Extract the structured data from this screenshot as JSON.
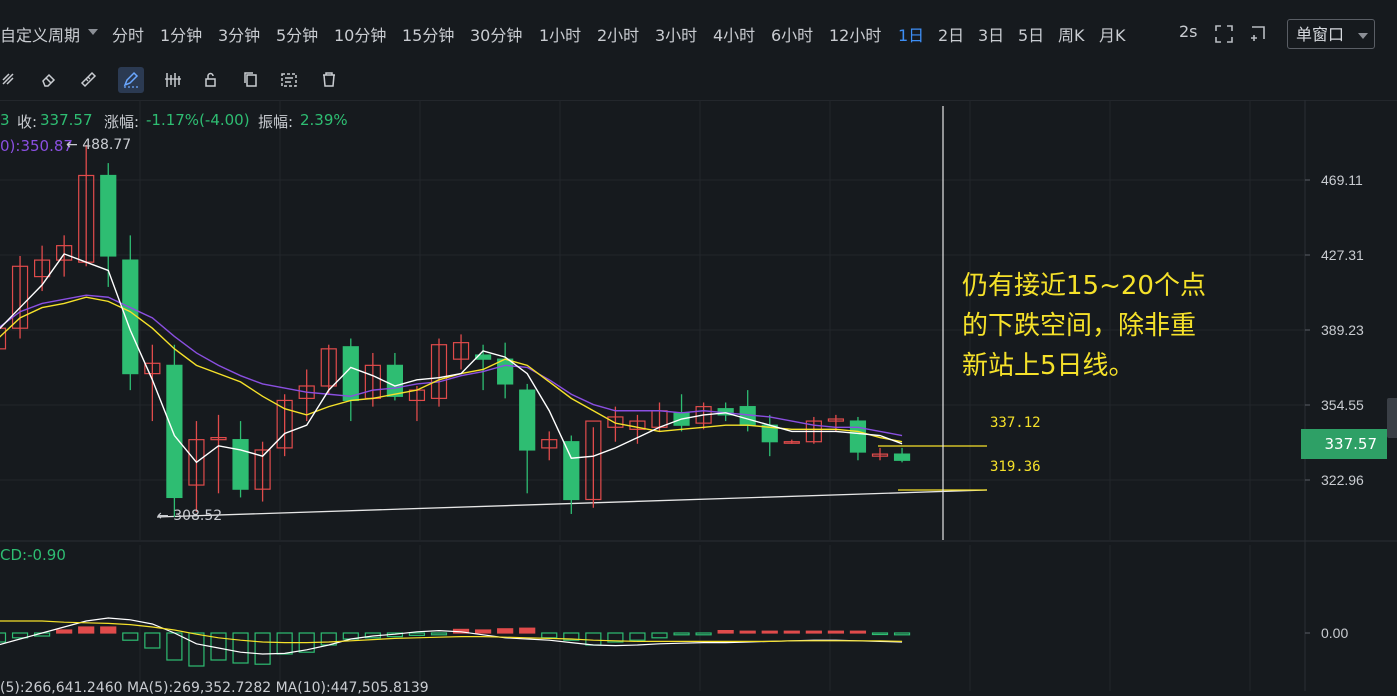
{
  "toolbar": {
    "periods": [
      "自定义周期",
      "分时",
      "1分钟",
      "3分钟",
      "5分钟",
      "10分钟",
      "15分钟",
      "30分钟",
      "1小时",
      "2小时",
      "3小时",
      "4小时",
      "6小时",
      "12小时",
      "1日",
      "2日",
      "3日",
      "5日",
      "周K",
      "月K"
    ],
    "active_period": "1日",
    "refresh": "2s",
    "window_mode": "单窗口",
    "drawing_tools": [
      "pattern-tool-icon",
      "eraser-icon",
      "ruler-icon",
      "pen-tool-icon",
      "candle-tool-icon",
      "lock-icon",
      "copy-icon",
      "settings-tool-icon",
      "trash-icon"
    ],
    "selected_tool": "pen-tool-icon"
  },
  "info": {
    "close_label": "收:",
    "close_value": "337.57",
    "change_label": "涨幅:",
    "change_value": "-1.17%(-4.00)",
    "amplitude_label": "振幅:",
    "amplitude_value": "2.39%",
    "ma_value": "0):350.87",
    "leading_digit": "3"
  },
  "annotation": {
    "text_lines": [
      "仍有接近15~20个点",
      "的下跌空间，除非重",
      "新站上5日线。"
    ],
    "level_upper": "337.12",
    "level_lower": "319.36"
  },
  "extremes": {
    "high": "488.77",
    "low": "308.52"
  },
  "macd": {
    "label": "CD:-0.90",
    "zero_label": "0.00",
    "bottom_text": "(5):266,641.2460  MA(5):269,352.7282  MA(10):447,505.8139"
  },
  "colors": {
    "up": "#e04b4b",
    "down": "#2ebd72",
    "ma5": "#ffffff",
    "ma10": "#f5e12a",
    "ma20": "#8a4fe0",
    "annotation": "#f5e12a",
    "price_tag": "#2ea066"
  },
  "chart_data": {
    "type": "candlestick",
    "y_ticks": [
      469.11,
      427.31,
      389.23,
      354.55,
      322.96
    ],
    "current_price": 337.57,
    "ylim": [
      301,
      500
    ],
    "candles": [
      {
        "o": 390,
        "h": 405,
        "l": 380,
        "c": 400
      },
      {
        "o": 400,
        "h": 435,
        "l": 395,
        "c": 430
      },
      {
        "o": 425,
        "h": 440,
        "l": 418,
        "c": 433
      },
      {
        "o": 433,
        "h": 445,
        "l": 425,
        "c": 440
      },
      {
        "o": 432,
        "h": 488.77,
        "l": 430,
        "c": 474
      },
      {
        "o": 474,
        "h": 480,
        "l": 420,
        "c": 435
      },
      {
        "o": 433,
        "h": 445,
        "l": 370,
        "c": 378
      },
      {
        "o": 378,
        "h": 392,
        "l": 355,
        "c": 383
      },
      {
        "o": 382,
        "h": 392,
        "l": 308.52,
        "c": 318
      },
      {
        "o": 324,
        "h": 355,
        "l": 311,
        "c": 346
      },
      {
        "o": 346,
        "h": 358,
        "l": 320,
        "c": 347
      },
      {
        "o": 346,
        "h": 355,
        "l": 318,
        "c": 322
      },
      {
        "o": 322,
        "h": 345,
        "l": 316,
        "c": 341
      },
      {
        "o": 342,
        "h": 368,
        "l": 338,
        "c": 365
      },
      {
        "o": 366,
        "h": 380,
        "l": 355,
        "c": 372
      },
      {
        "o": 372,
        "h": 392,
        "l": 368,
        "c": 390
      },
      {
        "o": 391,
        "h": 395,
        "l": 355,
        "c": 365
      },
      {
        "o": 366,
        "h": 388,
        "l": 362,
        "c": 382
      },
      {
        "o": 382,
        "h": 388,
        "l": 365,
        "c": 367
      },
      {
        "o": 365,
        "h": 372,
        "l": 355,
        "c": 370
      },
      {
        "o": 366,
        "h": 395,
        "l": 362,
        "c": 392
      },
      {
        "o": 385,
        "h": 397,
        "l": 380,
        "c": 393
      },
      {
        "o": 387,
        "h": 392,
        "l": 370,
        "c": 385
      },
      {
        "o": 385,
        "h": 393,
        "l": 366,
        "c": 373
      },
      {
        "o": 370,
        "h": 373,
        "l": 320,
        "c": 341
      },
      {
        "o": 342,
        "h": 350,
        "l": 336,
        "c": 346
      },
      {
        "o": 345,
        "h": 348,
        "l": 310,
        "c": 317
      },
      {
        "o": 317,
        "h": 352,
        "l": 313,
        "c": 355
      },
      {
        "o": 352,
        "h": 362,
        "l": 345,
        "c": 357
      },
      {
        "o": 351,
        "h": 358,
        "l": 344,
        "c": 355
      },
      {
        "o": 352,
        "h": 364,
        "l": 350,
        "c": 360
      },
      {
        "o": 359,
        "h": 368,
        "l": 350,
        "c": 353
      },
      {
        "o": 354,
        "h": 364,
        "l": 351,
        "c": 362
      },
      {
        "o": 361,
        "h": 364,
        "l": 355,
        "c": 358
      },
      {
        "o": 362,
        "h": 370,
        "l": 350,
        "c": 353
      },
      {
        "o": 353,
        "h": 358,
        "l": 338,
        "c": 345
      },
      {
        "o": 345,
        "h": 346,
        "l": 344,
        "c": 345
      },
      {
        "o": 345,
        "h": 357,
        "l": 344,
        "c": 355
      },
      {
        "o": 355,
        "h": 358,
        "l": 350,
        "c": 356
      },
      {
        "o": 355,
        "h": 357,
        "l": 336,
        "c": 340
      },
      {
        "o": 338,
        "h": 342,
        "l": 336,
        "c": 339
      },
      {
        "o": 339,
        "h": 342,
        "l": 335,
        "c": 336
      }
    ],
    "ma5": [
      399,
      410,
      421,
      436,
      432,
      428,
      399,
      375,
      348,
      335,
      343,
      341,
      338,
      349,
      353,
      370,
      381,
      377,
      372,
      375,
      376,
      378,
      389,
      386,
      378,
      360,
      337,
      338,
      342,
      347,
      352,
      356,
      358,
      359,
      356,
      353,
      350,
      350,
      350,
      349,
      348,
      344
    ],
    "ma10": [
      395,
      405,
      410,
      412,
      415,
      413,
      408,
      400,
      390,
      382,
      378,
      374,
      367,
      361,
      358,
      362,
      365,
      366,
      368,
      370,
      375,
      378,
      380,
      385,
      382,
      374,
      366,
      360,
      354,
      352,
      350,
      351,
      352,
      353,
      353,
      352,
      351,
      351,
      351,
      350,
      347,
      345
    ],
    "ma20": [
      400,
      408,
      412,
      414,
      416,
      415,
      410,
      405,
      396,
      388,
      382,
      377,
      373,
      371,
      369,
      368,
      367,
      370,
      371,
      373,
      374,
      377,
      379,
      382,
      381,
      375,
      368,
      363,
      360,
      360,
      360,
      359,
      360,
      359,
      358,
      357,
      355,
      353,
      352,
      352,
      350,
      348
    ],
    "trendline": [
      [
        308.52,
        0
      ],
      [
        320.5,
        1
      ]
    ],
    "macd_hist": [
      -1.5,
      -0.8,
      -0.5,
      0.5,
      1.0,
      1.0,
      -1.2,
      -2.5,
      -4.5,
      -5.5,
      -4.5,
      -5.0,
      -5.2,
      -3.5,
      -3.2,
      -2.0,
      -1.0,
      -0.8,
      -0.6,
      -0.4,
      -0.3,
      0.6,
      0.5,
      0.7,
      0.8,
      -0.8,
      -1.2,
      -2.0,
      -1.5,
      -1.2,
      -0.8,
      -0.3,
      -0.3,
      0.4,
      0.3,
      0.3,
      0.3,
      0.3,
      0.3,
      0.3,
      -0.2,
      -0.3
    ],
    "macd_dif": [
      -2,
      -1,
      0,
      1,
      2,
      2.5,
      2.2,
      1.5,
      0,
      -1.8,
      -2.5,
      -3.2,
      -3.5,
      -3.4,
      -2.8,
      -2.0,
      -1.0,
      -0.5,
      -0.2,
      0.2,
      0.4,
      0.2,
      -0.3,
      -0.8,
      -1.0,
      -1.2,
      -1.6,
      -2.0,
      -2.1,
      -2.0,
      -1.8,
      -1.7,
      -1.6,
      -1.6,
      -1.5,
      -1.4,
      -1.3,
      -1.2,
      -1.2,
      -1.3,
      -1.4,
      -1.5
    ],
    "macd_dea": [
      2.0,
      2.0,
      2.0,
      1.8,
      1.7,
      1.6,
      1.4,
      1.0,
      0.5,
      -0.2,
      -0.8,
      -1.2,
      -1.5,
      -1.6,
      -1.6,
      -1.5,
      -1.3,
      -1.1,
      -0.9,
      -0.8,
      -0.7,
      -0.6,
      -0.6,
      -0.7,
      -0.8,
      -0.9,
      -1.0,
      -1.2,
      -1.3,
      -1.4,
      -1.4,
      -1.4,
      -1.4,
      -1.4,
      -1.4,
      -1.4,
      -1.3,
      -1.3,
      -1.3,
      -1.3,
      -1.3,
      -1.4
    ]
  }
}
